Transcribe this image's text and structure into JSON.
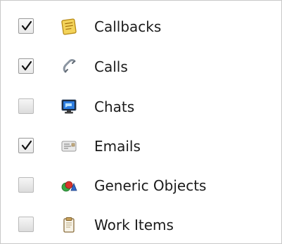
{
  "items": [
    {
      "label": "Callbacks",
      "checked": true,
      "icon": "callback-note-icon"
    },
    {
      "label": "Calls",
      "checked": true,
      "icon": "phone-handset-icon"
    },
    {
      "label": "Chats",
      "checked": false,
      "icon": "chat-monitor-icon"
    },
    {
      "label": "Emails",
      "checked": true,
      "icon": "email-icon"
    },
    {
      "label": "Generic Objects",
      "checked": false,
      "icon": "generic-objects-icon"
    },
    {
      "label": "Work Items",
      "checked": false,
      "icon": "clipboard-icon"
    }
  ],
  "colors": {
    "border": "#c9c9c9",
    "text": "#1b1b1b"
  }
}
